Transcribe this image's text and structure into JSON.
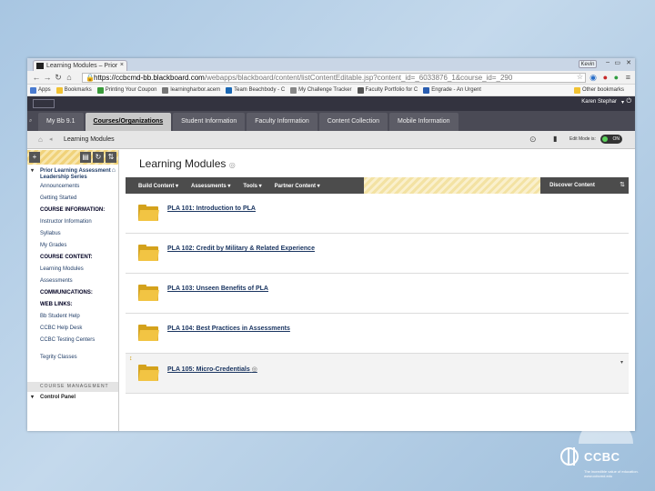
{
  "browser": {
    "tab_title": "Learning Modules – Prior",
    "close_glyph": "×",
    "user_chip": "Kevin",
    "url_host": "https://ccbcmd-bb.blackboard.com",
    "url_path": "/webapps/blackboard/content/listContentEditable.jsp?content_id=_6033876_1&course_id=_290",
    "bookmarks": [
      {
        "label": "Apps",
        "color": "#4a7bd0"
      },
      {
        "label": "Bookmarks",
        "color": "#f1c232"
      },
      {
        "label": "Printing Your Coupon",
        "color": "#3a9a3a"
      },
      {
        "label": "learningharbor.acem",
        "color": "#777777"
      },
      {
        "label": "Team Beachbody - C",
        "color": "#1a67b3"
      },
      {
        "label": "My Challenge Tracker",
        "color": "#888888"
      },
      {
        "label": "Faculty Portfolio for C",
        "color": "#555555"
      },
      {
        "label": "Engrade - An Urgent",
        "color": "#2a5db0"
      }
    ],
    "other_bookmarks": "Other bookmarks"
  },
  "bb": {
    "user_name": "Karen Stephar",
    "tabs": [
      {
        "label": "My Bb 9.1",
        "active": false
      },
      {
        "label": "Courses/Organizations",
        "active": true
      },
      {
        "label": "Student Information",
        "active": false
      },
      {
        "label": "Faculty Information",
        "active": false
      },
      {
        "label": "Content Collection",
        "active": false
      },
      {
        "label": "Mobile Information",
        "active": false
      }
    ],
    "breadcrumb": "Learning Modules",
    "edit_mode_label": "Edit Mode is:",
    "edit_mode_value": "ON"
  },
  "course_menu": {
    "course_title": "Prior Learning Assessment Leadership Series",
    "items": [
      {
        "label": "Announcements",
        "type": "link"
      },
      {
        "label": "Getting Started",
        "type": "link"
      },
      {
        "label": "COURSE INFORMATION:",
        "type": "head"
      },
      {
        "label": "Instructor Information",
        "type": "link"
      },
      {
        "label": "Syllabus",
        "type": "link"
      },
      {
        "label": "My Grades",
        "type": "link"
      },
      {
        "label": "COURSE CONTENT:",
        "type": "head"
      },
      {
        "label": "Learning Modules",
        "type": "link"
      },
      {
        "label": "Assessments",
        "type": "link"
      },
      {
        "label": "COMMUNICATIONS:",
        "type": "head"
      },
      {
        "label": "WEB LINKS:",
        "type": "head"
      },
      {
        "label": "Bb Student Help",
        "type": "link"
      },
      {
        "label": "CCBC Help Desk",
        "type": "link"
      },
      {
        "label": "CCBC Testing Centers",
        "type": "link"
      },
      {
        "label": "",
        "type": "divider"
      },
      {
        "label": "Tegrity Classes",
        "type": "link"
      }
    ],
    "management_head": "COURSE MANAGEMENT",
    "control_panel": "Control Panel"
  },
  "main": {
    "title": "Learning Modules",
    "action_buttons": [
      "Build Content",
      "Assessments",
      "Tools",
      "Partner Content"
    ],
    "discover": "Discover Content",
    "modules": [
      "PLA 101: Introduction to PLA",
      "PLA 102: Credit by Military & Related Experience",
      "PLA 103: Unseen Benefits of PLA",
      "PLA 104: Best Practices in Assessments",
      "PLA 105: Micro-Credentials"
    ]
  },
  "branding": {
    "name": "CCBC",
    "tagline": "The incredible value of education. www.ccbcmd.edu"
  }
}
